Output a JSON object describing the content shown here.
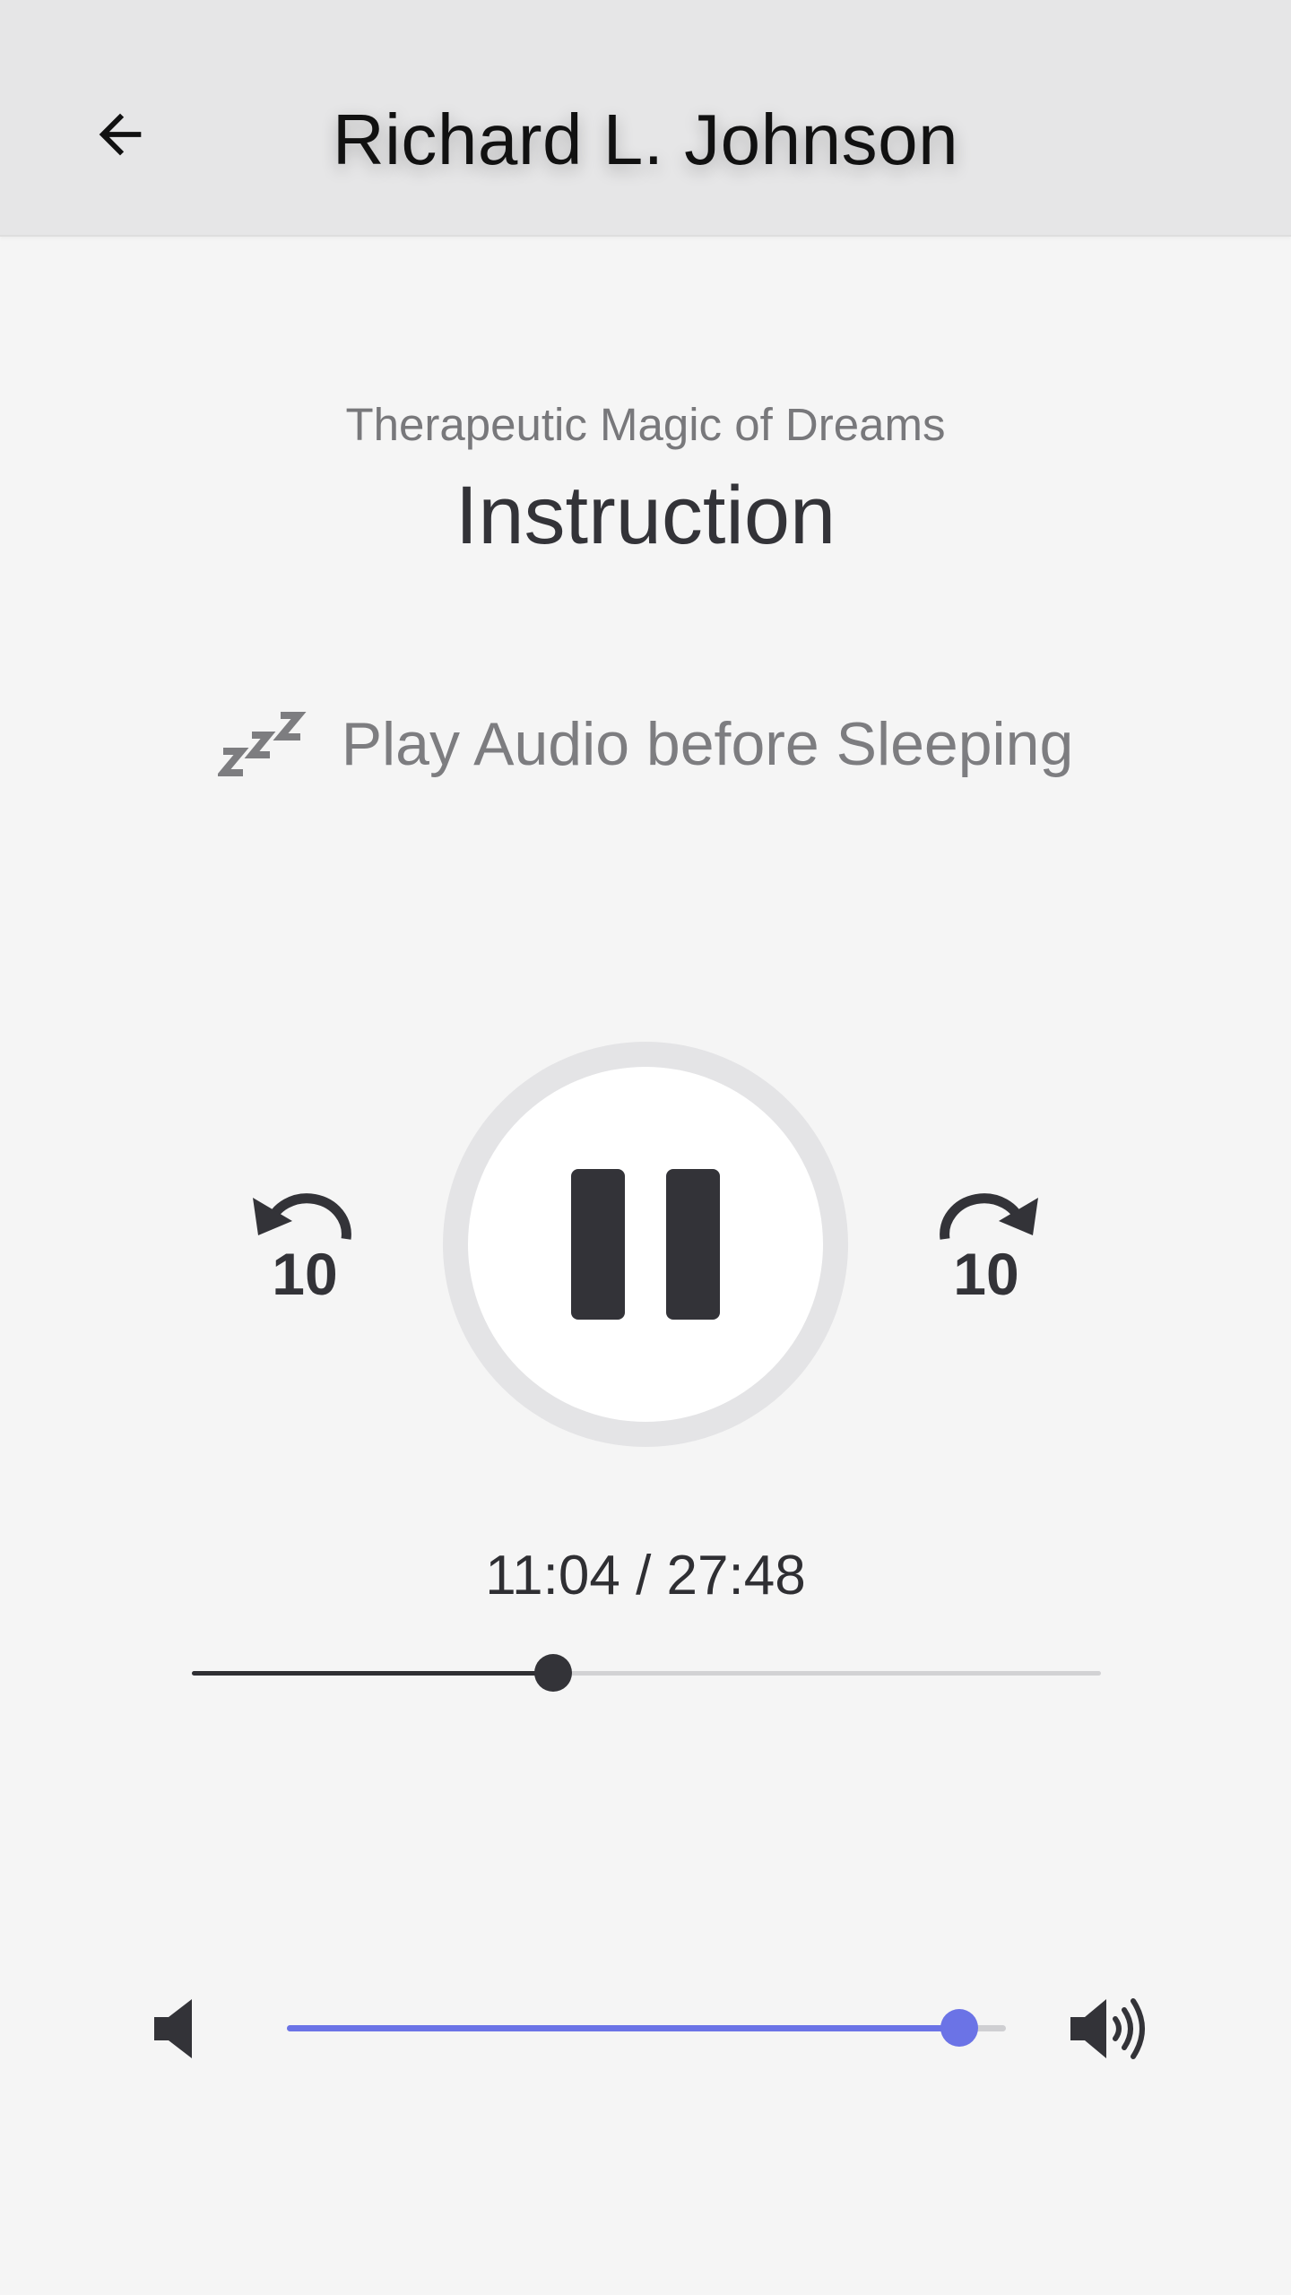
{
  "header": {
    "title": "Richard L. Johnson",
    "back_icon": "arrow-left-icon"
  },
  "content": {
    "subtitle": "Therapeutic Magic of Dreams",
    "title": "Instruction",
    "sleep_hint": {
      "icon": "zzz-icon",
      "text": "Play Audio before Sleeping"
    }
  },
  "player": {
    "state": "playing",
    "pause_icon": "pause-icon",
    "rewind_icon": "rewind-10-icon",
    "rewind_label": "10",
    "forward_icon": "forward-10-icon",
    "forward_label": "10",
    "time_text": "11:04 / 27:48",
    "progress_fraction": 0.397
  },
  "volume": {
    "low_icon": "volume-low-icon",
    "high_icon": "volume-high-icon",
    "level_fraction": 0.935
  },
  "colors": {
    "accent": "#6b73e6",
    "dark": "#333338",
    "header_bg": "#e6e6e7",
    "background": "#f5f5f5"
  }
}
